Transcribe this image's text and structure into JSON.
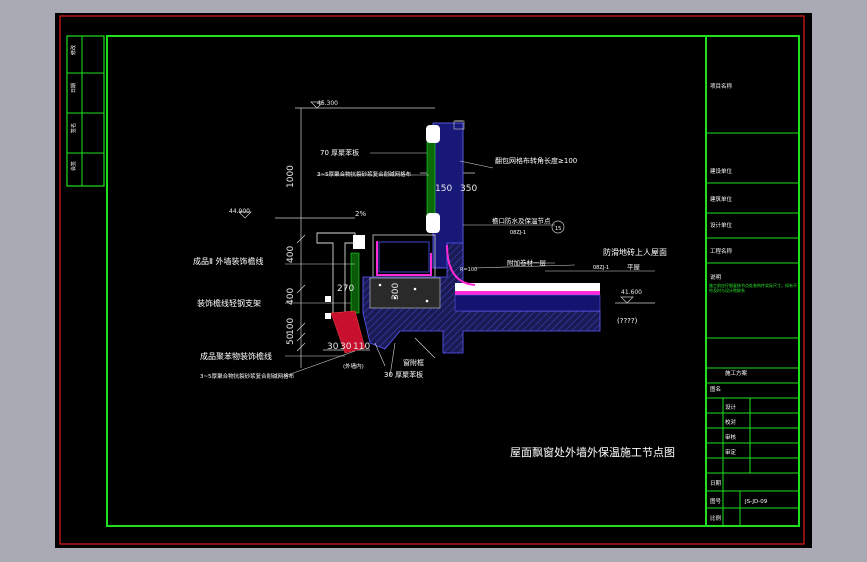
{
  "drawing": {
    "title": "屋面飘窗处外墙外保温施工节点图",
    "elevations": {
      "top": "45.300",
      "mid": "44.900",
      "right": "41.600"
    },
    "dims": {
      "d1000": "1000",
      "d400a": "400",
      "d400b": "400",
      "d270": "270",
      "d300": "300",
      "d100": "100",
      "d50": "50",
      "d150": "150",
      "d350": "350",
      "d30a": "30",
      "d30b": "30",
      "d110": "110",
      "slope": "2%",
      "r1": "R=100"
    },
    "labels": {
      "l1": "70 厚聚苯板",
      "l2": "3~5厚聚合物抗裂砂浆复合耐碱网格布",
      "l3": "翻包网格布转角长度≥100",
      "l4": "檐口防水及保温节点",
      "l5": "附加卷材一层",
      "l6": "防滑地砖上人屋面",
      "l7": "平屋",
      "l8": "成品Ⅱ 外墙装饰檐线",
      "l9": "装饰檐线轻钢支架",
      "l10": "成品聚苯物装饰檐线",
      "l11": "3~5厚聚合物抗裂砂浆复合耐碱网格布",
      "l12": "窗附框",
      "l13": "30 厚聚苯板",
      "l14": "(????)",
      "l15": "08ZJ-1",
      "l16": "15",
      "l17": "(外墙内)"
    }
  },
  "title_block": {
    "rows": [
      "项目名称",
      "建设单位",
      "建筑单位",
      "设计单位",
      "工程名称",
      "说明"
    ],
    "stage": "施工方案",
    "drawing_name_label": "图名",
    "sign_rows": [
      "设计",
      "校对",
      "审核",
      "审定"
    ],
    "date_label": "日期",
    "sheet_no_label": "图号",
    "sheet_no": "JS-JD-09",
    "scale_label": "比例",
    "small_note": "施工前应仔细复核节点处各构件实际尺寸，如有不符及时与设计院联系"
  },
  "left_strip": {
    "items": [
      "修改",
      "日期",
      "签名",
      "会签",
      "专业"
    ]
  }
}
